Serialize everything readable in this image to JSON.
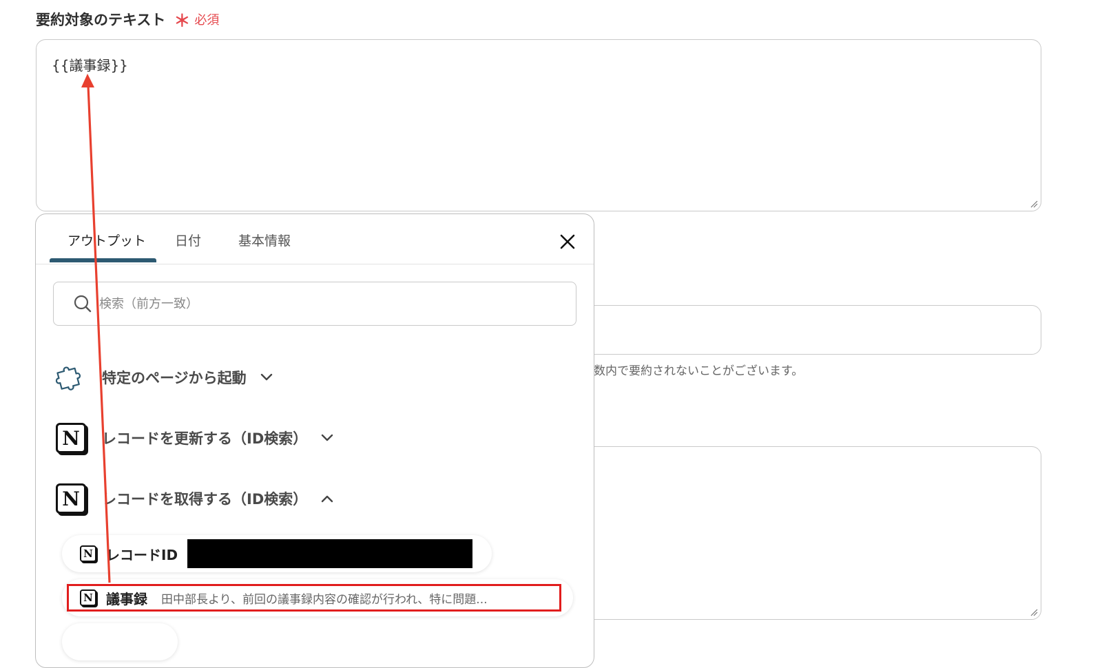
{
  "field": {
    "label": "要約対象のテキスト",
    "required_mark": "＊",
    "required_text": "必須",
    "value": "{{議事録}}"
  },
  "background": {
    "note": "数内で要約されないことがございます。"
  },
  "popup": {
    "tabs": [
      {
        "label": "アウトプット",
        "active": true
      },
      {
        "label": "日付",
        "active": false
      },
      {
        "label": "基本情報",
        "active": false
      }
    ],
    "search_placeholder": "検索（前方一致）",
    "groups": [
      {
        "label": "特定のページから起動",
        "icon": "puzzle-icon",
        "expanded": false
      },
      {
        "label": "レコードを更新する（ID検索）",
        "icon": "notion-icon",
        "expanded": false
      },
      {
        "label": "レコードを取得する（ID検索）",
        "icon": "notion-icon",
        "expanded": true
      }
    ],
    "items": [
      {
        "label": "レコードID",
        "value": "",
        "redacted": true
      },
      {
        "label": "議事録",
        "value": "田中部長より、前回の議事録内容の確認が行われ、特に問題..."
      }
    ]
  },
  "colors": {
    "required": "#e5484d",
    "tab_underline": "#2d5a72",
    "highlight": "#e11d1d",
    "arrow": "#e8402f"
  }
}
